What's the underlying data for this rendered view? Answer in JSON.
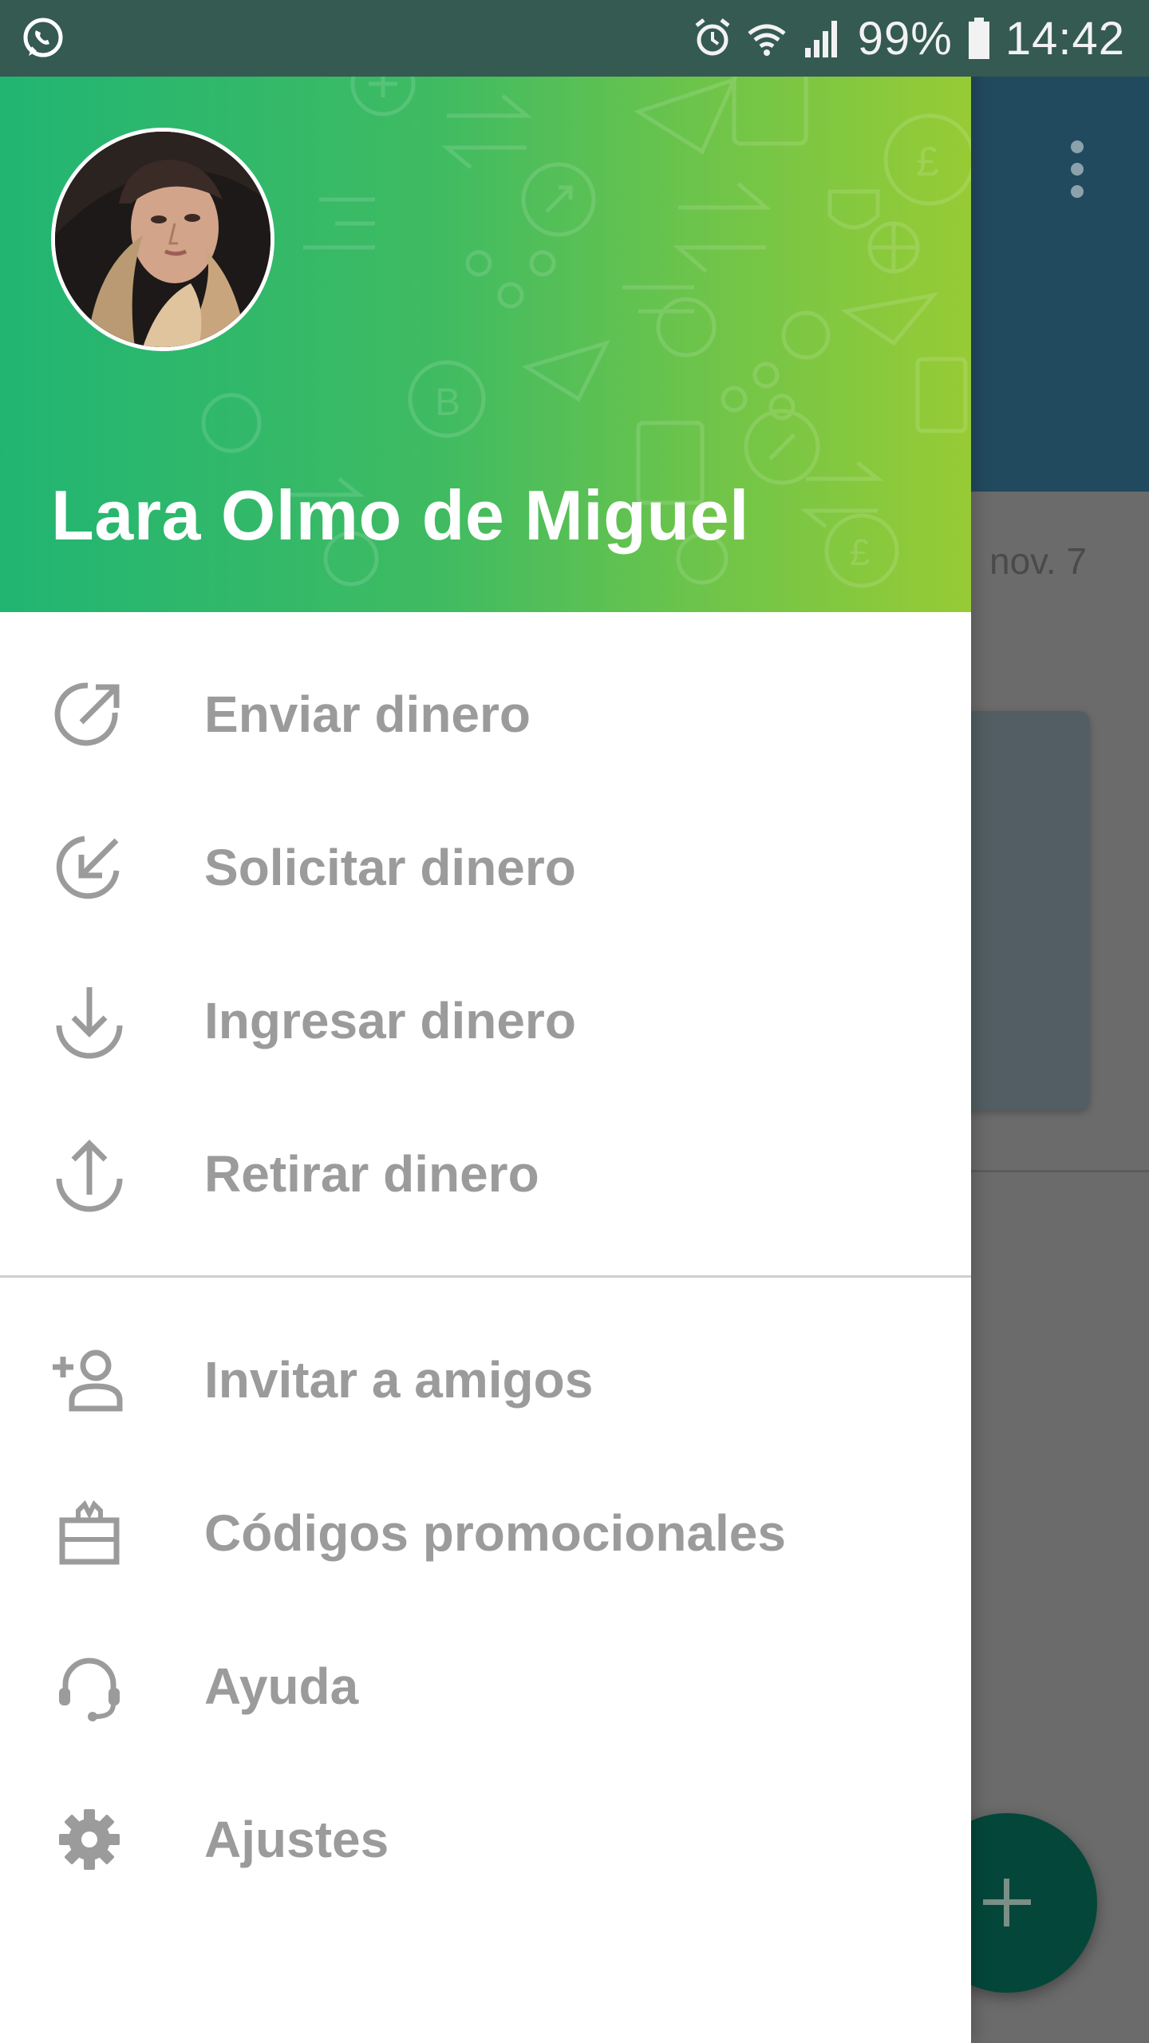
{
  "status_bar": {
    "left_icon": "whatsapp-icon",
    "alarm_icon": "alarm-icon",
    "wifi_icon": "wifi-icon",
    "signal_icon": "signal-icon",
    "battery_percent": "99%",
    "battery_icon": "battery-icon",
    "time": "14:42"
  },
  "background_app": {
    "date_label": "nov. 7",
    "more_icon": "more-vertical-icon",
    "fab_icon": "plus-icon",
    "header_color": "#224a5e",
    "fab_color": "#04473a"
  },
  "drawer": {
    "header_gradient": [
      "#21b573",
      "#97cb35"
    ],
    "user_name": "Lara Olmo de Miguel",
    "avatar": "profile-photo",
    "primary_items": [
      {
        "label": "Enviar dinero",
        "icon": "send-money-icon"
      },
      {
        "label": "Solicitar dinero",
        "icon": "request-money-icon"
      },
      {
        "label": "Ingresar dinero",
        "icon": "deposit-icon"
      },
      {
        "label": "Retirar dinero",
        "icon": "withdraw-icon"
      }
    ],
    "secondary_items": [
      {
        "label": "Invitar a amigos",
        "icon": "invite-friend-icon"
      },
      {
        "label": "Códigos promocionales",
        "icon": "gift-icon"
      },
      {
        "label": "Ayuda",
        "icon": "headset-icon"
      },
      {
        "label": "Ajustes",
        "icon": "gear-icon"
      }
    ]
  }
}
